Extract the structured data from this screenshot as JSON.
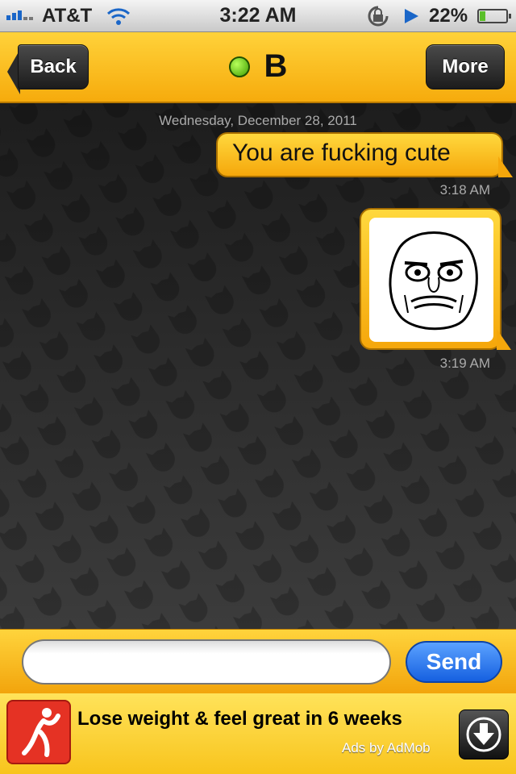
{
  "status_bar": {
    "carrier": "AT&T",
    "time": "3:22 AM",
    "battery": "22%",
    "battery_level": 0.22,
    "signal_icon": "signal-bars-icon",
    "wifi_icon": "wifi-icon",
    "lock_icon": "rotation-lock-icon",
    "play_icon": "play-icon"
  },
  "nav": {
    "back_label": "Back",
    "title": "B",
    "more_label": "More",
    "online_status_icon": "online-dot-icon"
  },
  "chat": {
    "date": "Wednesday, December 28, 2011",
    "messages": [
      {
        "text": "You are fucking cute",
        "time": "3:18 AM"
      },
      {
        "image": "me-gusta-face",
        "time": "3:19 AM"
      }
    ]
  },
  "composer": {
    "placeholder": "",
    "value": "",
    "send_label": "Send"
  },
  "ad": {
    "text": "Lose weight & feel great in 6 weeks",
    "attribution": "Ads by AdMob",
    "download_icon": "download-arrow-icon",
    "logo_icon": "fitness-logo-icon"
  },
  "colors": {
    "accent": "#f6ab0c",
    "send_button": "#1a66e6",
    "online": "#56c000"
  }
}
